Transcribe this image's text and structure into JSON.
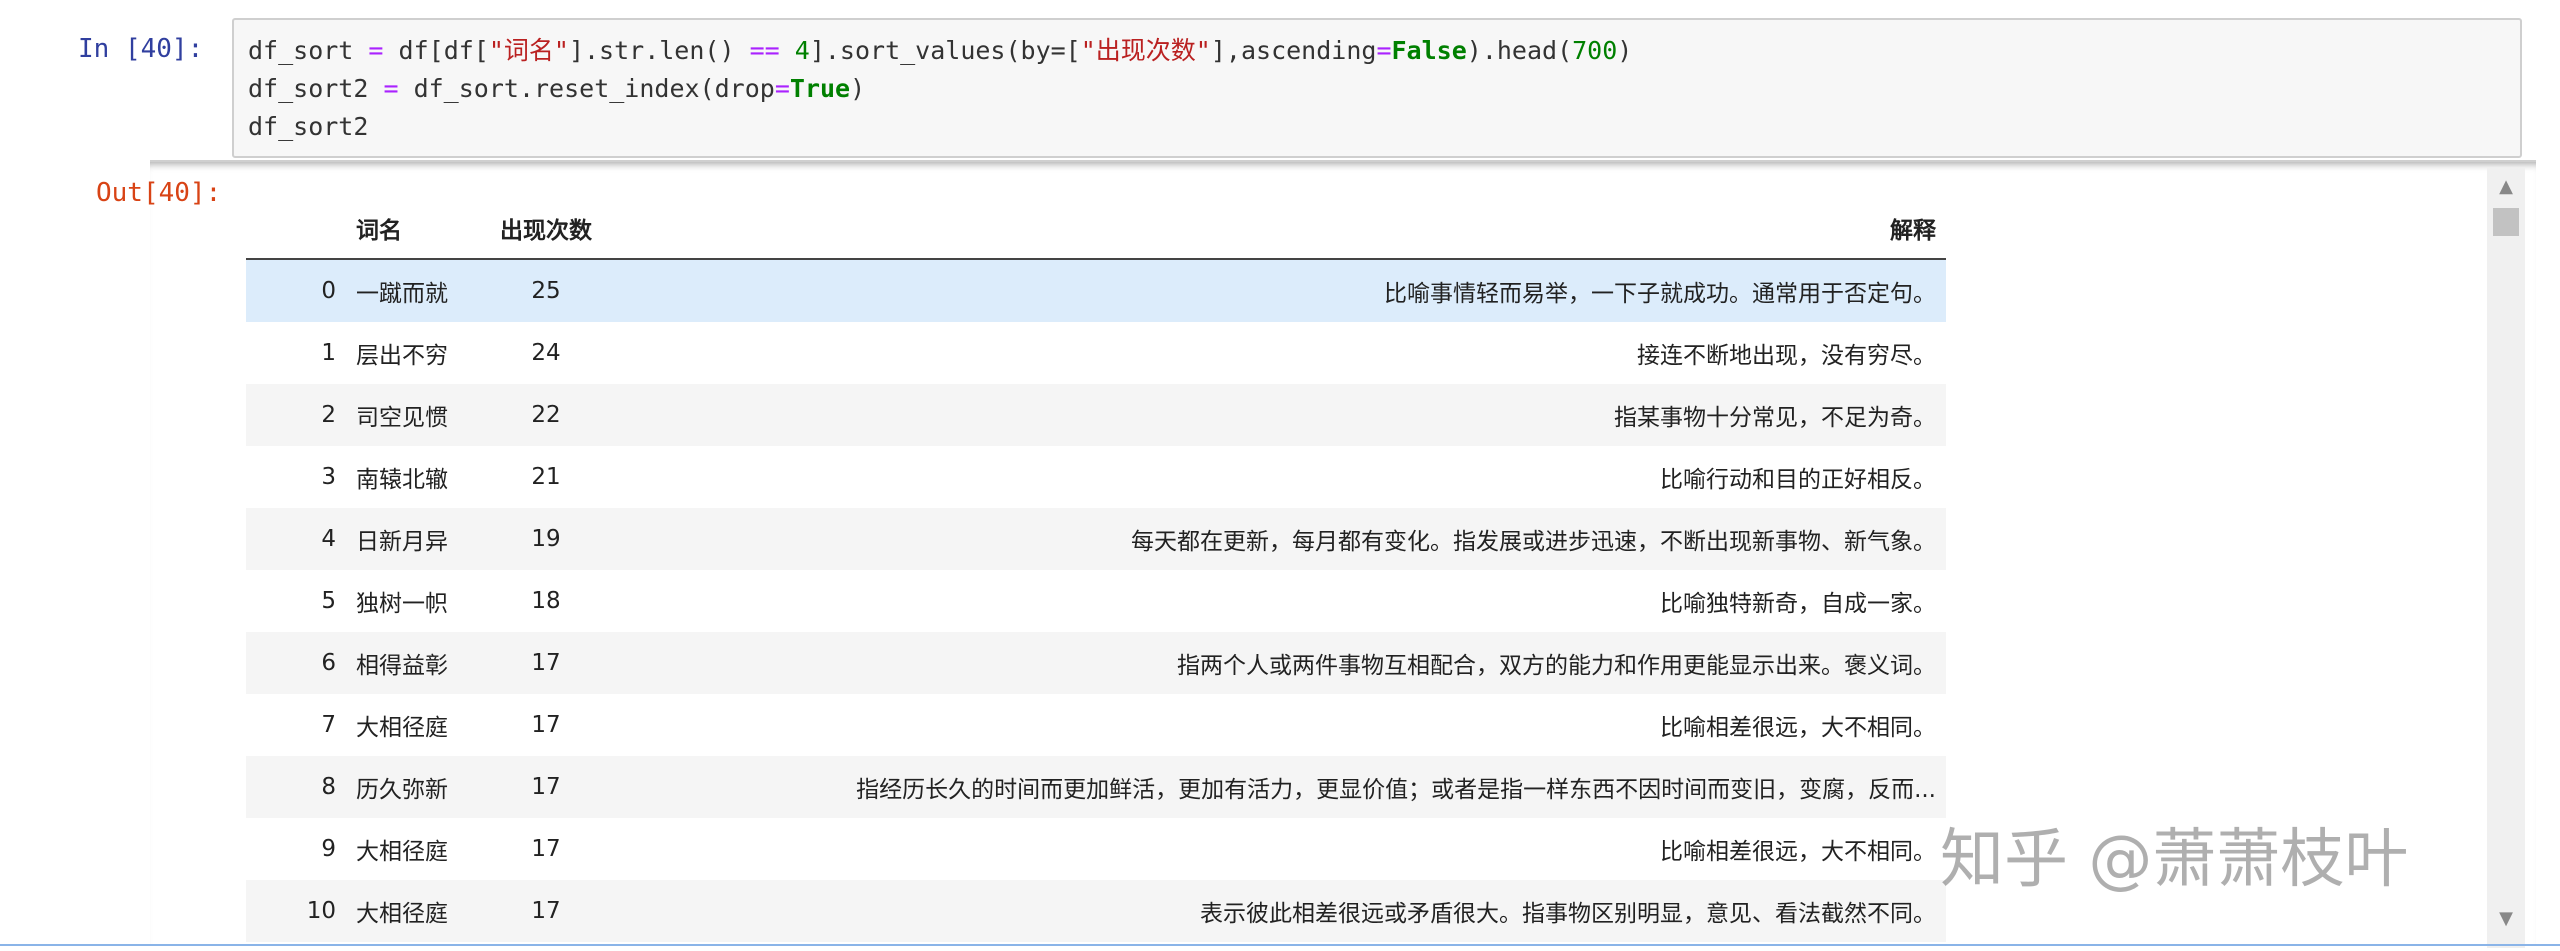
{
  "cell": {
    "in_prompt": "In  [40]:",
    "out_prompt": "Out[40]:",
    "code": {
      "l1_a": "df_sort ",
      "l1_eq": "=",
      "l1_b": " df[df[",
      "l1_s1": "\"词名\"",
      "l1_c": "].str.len() ",
      "l1_op": "==",
      "l1_sp": " ",
      "l1_n4": "4",
      "l1_d": "].sort_values(by=[",
      "l1_s2": "\"出现次数\"",
      "l1_e": "],ascending",
      "l1_eq2": "=",
      "l1_false": "False",
      "l1_f": ").head(",
      "l1_n700": "700",
      "l1_g": ")",
      "l2_a": "df_sort2 ",
      "l2_eq": "=",
      "l2_b": " df_sort.reset_index(drop",
      "l2_eq2": "=",
      "l2_true": "True",
      "l2_c": ")",
      "l3": "df_sort2"
    }
  },
  "table": {
    "columns": [
      "",
      "词名",
      "出现次数",
      "解释"
    ],
    "rows": [
      {
        "idx": "0",
        "word": "一蹴而就",
        "count": "25",
        "exp": "比喻事情轻而易举，一下子就成功。通常用于否定句。"
      },
      {
        "idx": "1",
        "word": "层出不穷",
        "count": "24",
        "exp": "接连不断地出现，没有穷尽。"
      },
      {
        "idx": "2",
        "word": "司空见惯",
        "count": "22",
        "exp": "指某事物十分常见，不足为奇。"
      },
      {
        "idx": "3",
        "word": "南辕北辙",
        "count": "21",
        "exp": "比喻行动和目的正好相反。"
      },
      {
        "idx": "4",
        "word": "日新月异",
        "count": "19",
        "exp": "每天都在更新，每月都有变化。指发展或进步迅速，不断出现新事物、新气象。"
      },
      {
        "idx": "5",
        "word": "独树一帜",
        "count": "18",
        "exp": "比喻独特新奇，自成一家。"
      },
      {
        "idx": "6",
        "word": "相得益彰",
        "count": "17",
        "exp": "指两个人或两件事物互相配合，双方的能力和作用更能显示出来。褒义词。"
      },
      {
        "idx": "7",
        "word": "大相径庭",
        "count": "17",
        "exp": "比喻相差很远，大不相同。"
      },
      {
        "idx": "8",
        "word": "历久弥新",
        "count": "17",
        "exp": "指经历长久的时间而更加鲜活，更加有活力，更显价值；或者是指一样东西不因时间而变旧，变腐，反而..."
      },
      {
        "idx": "9",
        "word": "大相径庭",
        "count": "17",
        "exp": "比喻相差很远，大不相同。"
      },
      {
        "idx": "10",
        "word": "大相径庭",
        "count": "17",
        "exp": "表示彼此相差很远或矛盾很大。指事物区别明显，意见、看法截然不同。"
      }
    ]
  },
  "watermark": "知乎 @萧萧枝叶"
}
